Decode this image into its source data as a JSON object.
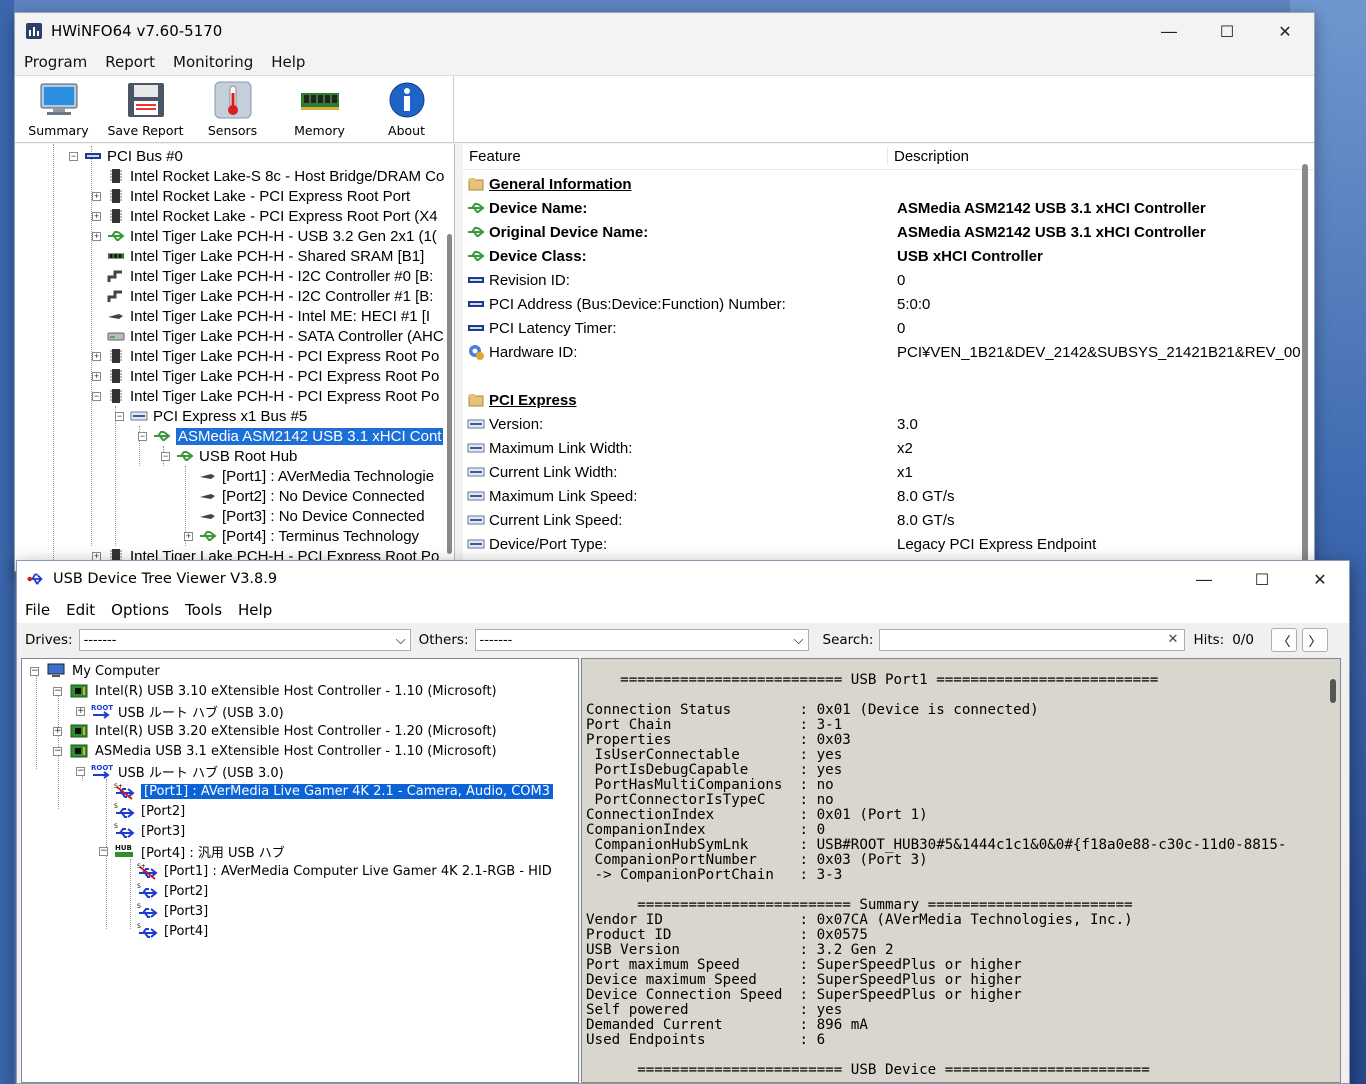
{
  "hwinfo": {
    "title": "HWiNFO64 v7.60-5170",
    "menu": [
      "Program",
      "Report",
      "Monitoring",
      "Help"
    ],
    "toolbar": [
      "Summary",
      "Save Report",
      "Sensors",
      "Memory",
      "About"
    ],
    "tree": [
      {
        "label": "PCI Bus #0",
        "icon": "pci-icon",
        "exp": "−"
      },
      {
        "label": "Intel Rocket Lake-S 8c - Host Bridge/DRAM Co",
        "icon": "chip-icon"
      },
      {
        "label": "Intel Rocket Lake - PCI Express Root Port",
        "icon": "chip-icon",
        "exp": "+"
      },
      {
        "label": "Intel Rocket Lake - PCI Express Root Port (X4",
        "icon": "chip-icon",
        "exp": "+"
      },
      {
        "label": "Intel Tiger Lake PCH-H - USB 3.2 Gen 2x1 (1(",
        "icon": "usb-icon",
        "exp": "+"
      },
      {
        "label": "Intel Tiger Lake PCH-H - Shared SRAM [B1]",
        "icon": "ram-icon"
      },
      {
        "label": "Intel Tiger Lake PCH-H - I2C Controller #0 [B:",
        "icon": "i2c-icon"
      },
      {
        "label": "Intel Tiger Lake PCH-H - I2C Controller #1 [B:",
        "icon": "i2c-icon"
      },
      {
        "label": "Intel Tiger Lake PCH-H - Intel ME: HECI #1 [I",
        "icon": "plug-icon"
      },
      {
        "label": "Intel Tiger Lake PCH-H - SATA Controller (AHC",
        "icon": "drive-icon"
      },
      {
        "label": "Intel Tiger Lake PCH-H - PCI Express Root Po",
        "icon": "chip-icon",
        "exp": "+"
      },
      {
        "label": "Intel Tiger Lake PCH-H - PCI Express Root Po",
        "icon": "chip-icon",
        "exp": "+"
      },
      {
        "label": "Intel Tiger Lake PCH-H - PCI Express Root Po",
        "icon": "chip-icon",
        "exp": "−"
      },
      {
        "label": "PCI Express x1 Bus #5",
        "icon": "pcie-icon",
        "exp": "−"
      },
      {
        "label": "ASMedia ASM2142 USB 3.1 xHCI Cont",
        "icon": "usb-icon",
        "exp": "−",
        "selected": true
      },
      {
        "label": "USB Root Hub",
        "icon": "usb-icon",
        "exp": "−"
      },
      {
        "label": "[Port1] : AVerMedia Technologie",
        "icon": "plug-icon"
      },
      {
        "label": "[Port2] : No Device Connected",
        "icon": "plug-icon"
      },
      {
        "label": "[Port3] : No Device Connected",
        "icon": "plug-icon"
      },
      {
        "label": "[Port4] : Terminus Technology",
        "icon": "usb-icon",
        "exp": "+"
      },
      {
        "label": "Intel Tiger Lake PCH-H - PCI Express Root Po",
        "icon": "chip-icon",
        "exp": "+"
      }
    ],
    "detail_header": {
      "feature": "Feature",
      "description": "Description"
    },
    "detail": [
      {
        "feature": "General Information",
        "value": "",
        "style": "section",
        "icon": "folder-icon"
      },
      {
        "feature": "Device Name:",
        "value": "ASMedia ASM2142 USB 3.1 xHCI Controller",
        "style": "bold",
        "icon": "usb-icon"
      },
      {
        "feature": "Original Device Name:",
        "value": "ASMedia ASM2142 USB 3.1 xHCI Controller",
        "style": "bold",
        "icon": "usb-icon"
      },
      {
        "feature": "Device Class:",
        "value": "USB xHCI Controller",
        "style": "bold",
        "icon": "usb-icon"
      },
      {
        "feature": "Revision ID:",
        "value": "0",
        "style": "normal",
        "icon": "pci-icon"
      },
      {
        "feature": "PCI Address (Bus:Device:Function) Number:",
        "value": "5:0:0",
        "style": "normal",
        "icon": "pci-icon"
      },
      {
        "feature": "PCI Latency Timer:",
        "value": "0",
        "style": "normal",
        "icon": "pci-icon"
      },
      {
        "feature": "Hardware ID:",
        "value": "PCI¥VEN_1B21&DEV_2142&SUBSYS_21421B21&REV_00",
        "style": "normal",
        "icon": "gear-icon"
      },
      {
        "feature": "",
        "value": "",
        "style": "blank",
        "icon": ""
      },
      {
        "feature": "PCI Express",
        "value": "",
        "style": "section",
        "icon": "folder-icon"
      },
      {
        "feature": "Version:",
        "value": "3.0",
        "style": "normal",
        "icon": "pcie-icon"
      },
      {
        "feature": "Maximum Link Width:",
        "value": "x2",
        "style": "normal",
        "icon": "pcie-icon"
      },
      {
        "feature": "Current Link Width:",
        "value": "x1",
        "style": "normal",
        "icon": "pcie-icon"
      },
      {
        "feature": "Maximum Link Speed:",
        "value": "8.0 GT/s",
        "style": "normal",
        "icon": "pcie-icon"
      },
      {
        "feature": "Current Link Speed:",
        "value": "8.0 GT/s",
        "style": "normal",
        "icon": "pcie-icon"
      },
      {
        "feature": "Device/Port Type:",
        "value": "Legacy PCI Express Endpoint",
        "style": "normal",
        "icon": "pcie-icon"
      }
    ]
  },
  "usbtv": {
    "title": "USB Device Tree Viewer V3.8.9",
    "menu": [
      "File",
      "Edit",
      "Options",
      "Tools",
      "Help"
    ],
    "drives_label": "Drives:",
    "drives_value": "-------",
    "others_label": "Others:",
    "others_value": "-------",
    "search_label": "Search:",
    "search_value": "",
    "hits_label": "Hits:",
    "hits_value": "0/0",
    "tree": [
      {
        "label": "My Computer",
        "icon": "computer-icon",
        "exp": "−"
      },
      {
        "label": "Intel(R) USB 3.10 eXtensible Host Controller - 1.10 (Microsoft)",
        "icon": "pcb-icon",
        "exp": "−"
      },
      {
        "label": "USB ルート ハブ (USB 3.0)",
        "icon": "root-icon",
        "exp": "+"
      },
      {
        "label": "Intel(R) USB 3.20 eXtensible Host Controller - 1.20 (Microsoft)",
        "icon": "pcb-icon",
        "exp": "+"
      },
      {
        "label": "ASMedia USB 3.1 eXtensible Host Controller - 1.10 (Microsoft)",
        "icon": "pcb-icon",
        "exp": "−"
      },
      {
        "label": "USB ルート ハブ (USB 3.0)",
        "icon": "root-icon",
        "exp": "−"
      },
      {
        "label": "[Port1] : AVerMedia Live Gamer 4K 2.1 - Camera, Audio, COM3",
        "icon": "usb-device-icon",
        "selected": true
      },
      {
        "label": "[Port2]",
        "icon": "usb-port-icon"
      },
      {
        "label": "[Port3]",
        "icon": "usb-port-icon"
      },
      {
        "label": "[Port4] : 汎用 USB ハブ",
        "icon": "hub-icon",
        "exp": "−"
      },
      {
        "label": "[Port1] : AVerMedia Computer Live Gamer 4K 2.1-RGB - HID",
        "icon": "usb-device-icon"
      },
      {
        "label": "[Port2]",
        "icon": "usb-port-icon"
      },
      {
        "label": "[Port3]",
        "icon": "usb-port-icon"
      },
      {
        "label": "[Port4]",
        "icon": "usb-port-icon"
      }
    ],
    "info_lines": [
      "    ========================== USB Port1 ==========================",
      "",
      "Connection Status        : 0x01 (Device is connected)",
      "Port Chain               : 3-1",
      "Properties               : 0x03",
      " IsUserConnectable       : yes",
      " PortIsDebugCapable      : yes",
      " PortHasMultiCompanions  : no",
      " PortConnectorIsTypeC    : no",
      "ConnectionIndex          : 0x01 (Port 1)",
      "CompanionIndex           : 0",
      " CompanionHubSymLnk      : USB#ROOT_HUB30#5&1444c1c1&0&0#{f18a0e88-c30c-11d0-8815-",
      " CompanionPortNumber     : 0x03 (Port 3)",
      " -> CompanionPortChain   : 3-3",
      "",
      "      ========================= Summary ========================",
      "Vendor ID                : 0x07CA (AVerMedia Technologies, Inc.)",
      "Product ID               : 0x0575",
      "USB Version              : 3.2 Gen 2",
      "Port maximum Speed       : SuperSpeedPlus or higher",
      "Device maximum Speed     : SuperSpeedPlus or higher",
      "Device Connection Speed  : SuperSpeedPlus or higher",
      "Self powered             : yes",
      "Demanded Current         : 896 mA",
      "Used Endpoints           : 6",
      "",
      "      ======================== USB Device ========================"
    ]
  }
}
